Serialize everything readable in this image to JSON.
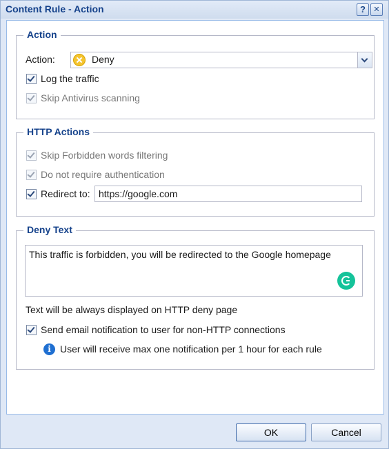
{
  "dialog": {
    "title": "Content Rule - Action",
    "help_glyph": "?",
    "close_glyph": "✕"
  },
  "action_group": {
    "legend": "Action",
    "action_label": "Action:",
    "action_value": "Deny",
    "action_icon": "deny-icon",
    "log_traffic": {
      "label": "Log the traffic",
      "checked": true,
      "enabled": true
    },
    "skip_antivirus": {
      "label": "Skip Antivirus scanning",
      "checked": true,
      "enabled": false
    }
  },
  "http_group": {
    "legend": "HTTP Actions",
    "skip_forbidden": {
      "label": "Skip Forbidden words filtering",
      "checked": true,
      "enabled": false
    },
    "no_auth": {
      "label": "Do not require authentication",
      "checked": true,
      "enabled": false
    },
    "redirect": {
      "label": "Redirect to:",
      "checked": true,
      "enabled": true,
      "url": "https://google.com"
    }
  },
  "deny_group": {
    "legend": "Deny Text",
    "text": "This traffic is forbidden, you will be redirected to the Google homepage",
    "hint": "Text will be always displayed on HTTP deny page",
    "email_notify": {
      "label": "Send email notification to user for non-HTTP connections",
      "checked": true,
      "enabled": true
    },
    "info_glyph": "i",
    "info_text": "User will receive max one notification per 1 hour for each rule"
  },
  "footer": {
    "ok_label": "OK",
    "cancel_label": "Cancel"
  },
  "colors": {
    "title_text": "#15428b",
    "window_bg": "#dfe8f6",
    "grammarly_green": "#15c39a",
    "info_blue": "#1f6fd1",
    "deny_yellow": "#f4c430"
  }
}
